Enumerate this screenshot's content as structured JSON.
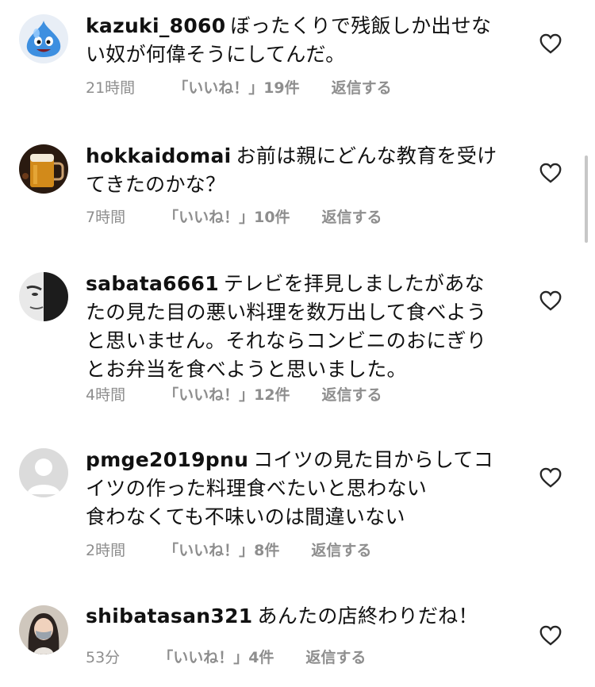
{
  "comments": [
    {
      "username": "kazuki_8060",
      "text_1": "ぼったくりで残飯しか出せな",
      "text_2": "い奴が何偉そうにしてんだ。",
      "time": "21時間",
      "likes": "「いいね！」19件",
      "reply": "返信する",
      "avatar": "slime-avatar"
    },
    {
      "username": "hokkaidomai",
      "text_1": "お前は親にどんな教育を受け",
      "text_2": "てきたのかな？",
      "time": "7時間",
      "likes": "「いいね！」10件",
      "reply": "返信する",
      "avatar": "beer-avatar"
    },
    {
      "username": "sabata6661",
      "text_1": "テレビを拝見しましたがあな",
      "text_2": "たの見た目の悪い料理を数万出して食べよう",
      "text_3": "と思いません。それならコンビニのおにぎり",
      "text_4": "とお弁当を食べようと思いました。",
      "time": "4時間",
      "likes": "「いいね！」12件",
      "reply": "返信する",
      "avatar": "face-avatar"
    },
    {
      "username": "pmge2019pnu",
      "text_1": "コイツの見た目からしてコ",
      "text_2": "イツの作った料理食べたいと思わない",
      "text_3": "食わなくても不味いのは間違いない",
      "time": "2時間",
      "likes": "「いいね！」8件",
      "reply": "返信する",
      "avatar": "default-avatar"
    },
    {
      "username": "shibatasan321",
      "text_1": "あんたの店終わりだね！",
      "time": "53分",
      "likes": "「いいね！」4件",
      "reply": "返信する",
      "avatar": "woman-avatar"
    }
  ],
  "colors": {
    "text": "#111111",
    "meta": "#8e8e8e",
    "heart": "#262626",
    "background": "#ffffff"
  },
  "icons": {
    "like": "heart-outline-icon"
  }
}
